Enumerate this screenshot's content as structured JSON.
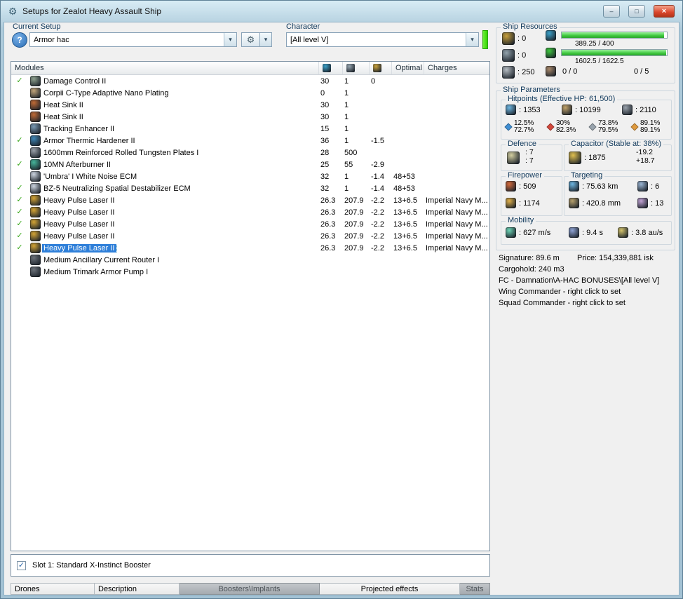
{
  "colors": {
    "selection_blue": "#2e7fd9",
    "check_green": "#33a513",
    "resource_bar_green": "#3ec83e",
    "character_status_green": "#35d400",
    "close_button_red": "#d9452b",
    "resist_em": "#3f8fd4",
    "resist_thermal": "#d4483c",
    "resist_kinetic": "#98a3ad",
    "resist_explosive": "#e09b3f"
  },
  "icons": {
    "window_glyph": "⚙",
    "help_glyph": "?",
    "tools_glyph": "⚙",
    "dropdown_glyph": "▾",
    "check_glyph": "✓",
    "minimize_glyph": "–",
    "maximize_glyph": "□",
    "close_glyph": "×"
  },
  "window": {
    "title": "Setups for Zealot Heavy Assault Ship"
  },
  "setup": {
    "current_setup_label": "Current Setup",
    "current_setup_value": "Armor hac",
    "character_label": "Character",
    "character_value": "[All level V]"
  },
  "modules": {
    "header_label": "Modules",
    "optimal_label": "Optimal",
    "charges_label": "Charges",
    "rows": [
      {
        "active": true,
        "icon": "damage-control",
        "name": "Damage Control II",
        "cpu": "30",
        "pg": "1",
        "cap": "0",
        "optimal": "",
        "charges": "",
        "selected": false
      },
      {
        "active": false,
        "icon": "adaptive-nano-plating",
        "name": "Corpii C-Type Adaptive Nano Plating",
        "cpu": "0",
        "pg": "1",
        "cap": "",
        "optimal": "",
        "charges": "",
        "selected": false
      },
      {
        "active": false,
        "icon": "heat-sink",
        "name": "Heat Sink II",
        "cpu": "30",
        "pg": "1",
        "cap": "",
        "optimal": "",
        "charges": "",
        "selected": false
      },
      {
        "active": false,
        "icon": "heat-sink",
        "name": "Heat Sink II",
        "cpu": "30",
        "pg": "1",
        "cap": "",
        "optimal": "",
        "charges": "",
        "selected": false
      },
      {
        "active": false,
        "icon": "tracking-enhancer",
        "name": "Tracking Enhancer II",
        "cpu": "15",
        "pg": "1",
        "cap": "",
        "optimal": "",
        "charges": "",
        "selected": false
      },
      {
        "active": true,
        "icon": "armor-hardener",
        "name": "Armor Thermic Hardener II",
        "cpu": "36",
        "pg": "1",
        "cap": "-1.5",
        "optimal": "",
        "charges": "",
        "selected": false
      },
      {
        "active": false,
        "icon": "armor-plate",
        "name": "1600mm Reinforced Rolled Tungsten Plates I",
        "cpu": "28",
        "pg": "500",
        "cap": "",
        "optimal": "",
        "charges": "",
        "selected": false
      },
      {
        "active": true,
        "icon": "afterburner",
        "name": "10MN Afterburner II",
        "cpu": "25",
        "pg": "55",
        "cap": "-2.9",
        "optimal": "",
        "charges": "",
        "selected": false
      },
      {
        "active": false,
        "icon": "ecm",
        "name": "'Umbra' I White Noise ECM",
        "cpu": "32",
        "pg": "1",
        "cap": "-1.4",
        "optimal": "48+53",
        "charges": "",
        "selected": false
      },
      {
        "active": true,
        "icon": "ecm",
        "name": "BZ-5 Neutralizing Spatial Destabilizer ECM",
        "cpu": "32",
        "pg": "1",
        "cap": "-1.4",
        "optimal": "48+53",
        "charges": "",
        "selected": false
      },
      {
        "active": true,
        "icon": "pulse-laser",
        "name": "Heavy Pulse Laser II",
        "cpu": "26.3",
        "pg": "207.9",
        "cap": "-2.2",
        "optimal": "13+6.5",
        "charges": "Imperial Navy M...",
        "selected": false
      },
      {
        "active": true,
        "icon": "pulse-laser",
        "name": "Heavy Pulse Laser II",
        "cpu": "26.3",
        "pg": "207.9",
        "cap": "-2.2",
        "optimal": "13+6.5",
        "charges": "Imperial Navy M...",
        "selected": false
      },
      {
        "active": true,
        "icon": "pulse-laser",
        "name": "Heavy Pulse Laser II",
        "cpu": "26.3",
        "pg": "207.9",
        "cap": "-2.2",
        "optimal": "13+6.5",
        "charges": "Imperial Navy M...",
        "selected": false
      },
      {
        "active": true,
        "icon": "pulse-laser",
        "name": "Heavy Pulse Laser II",
        "cpu": "26.3",
        "pg": "207.9",
        "cap": "-2.2",
        "optimal": "13+6.5",
        "charges": "Imperial Navy M...",
        "selected": false
      },
      {
        "active": true,
        "icon": "pulse-laser",
        "name": "Heavy Pulse Laser II",
        "cpu": "26.3",
        "pg": "207.9",
        "cap": "-2.2",
        "optimal": "13+6.5",
        "charges": "Imperial Navy M...",
        "selected": true
      },
      {
        "active": false,
        "icon": "rig",
        "name": "Medium Ancillary Current Router I",
        "cpu": "",
        "pg": "",
        "cap": "",
        "optimal": "",
        "charges": "",
        "selected": false
      },
      {
        "active": false,
        "icon": "rig",
        "name": "Medium Trimark Armor Pump I",
        "cpu": "",
        "pg": "",
        "cap": "",
        "optimal": "",
        "charges": "",
        "selected": false
      }
    ]
  },
  "booster": {
    "label": "Slot 1: Standard X-Instinct Booster",
    "checked": true
  },
  "bottom_tabs": [
    {
      "label": "Drones",
      "pressed": false
    },
    {
      "label": "Description",
      "pressed": false
    },
    {
      "label": "Boosters\\Implants",
      "pressed": true
    },
    {
      "label": "Projected effects",
      "pressed": false
    },
    {
      "label": "Stats",
      "pressed": true
    }
  ],
  "ship_resources": {
    "title": "Ship Resources",
    "turret_hardpoints": "0",
    "launcher_hardpoints": "0",
    "calibration": "250",
    "cpu_text": "389.25 / 400",
    "cpu_pct": 97,
    "powergrid_text": "1602.5 / 1622.5",
    "powergrid_pct": 99,
    "drone_bay": "0 / 0",
    "drone_slots": "0 / 5"
  },
  "ship_parameters": {
    "title": "Ship Parameters",
    "hitpoints": {
      "title": "Hitpoints (Effective HP: 61,500)",
      "shield": "1353",
      "armor": "10199",
      "hull": "2110",
      "resists": [
        {
          "type": "em",
          "shield": "12.5%",
          "armor": "72.7%"
        },
        {
          "type": "thermal",
          "shield": "30%",
          "armor": "82.3%"
        },
        {
          "type": "kinetic",
          "shield": "73.8%",
          "armor": "79.5%"
        },
        {
          "type": "explosive",
          "shield": "89.1%",
          "armor": "89.1%"
        }
      ]
    },
    "defence": {
      "title": "Defence",
      "value1": "7",
      "value2": "7"
    },
    "capacitor": {
      "title": "Capacitor (Stable at: 38%)",
      "capacity": "1875",
      "usage": "-19.2",
      "recharge": "+18.7"
    },
    "firepower": {
      "title": "Firepower",
      "dps": "509",
      "volley": "1174"
    },
    "targeting": {
      "title": "Targeting",
      "range": "75.63 km",
      "max_targets": "6",
      "scan_resolution": "420.8 mm",
      "sensor_strength": "13"
    },
    "mobility": {
      "title": "Mobility",
      "speed": "627 m/s",
      "align_time": "9.4 s",
      "warp_speed": "3.8 au/s"
    }
  },
  "summary": {
    "signature": "Signature: 89.6 m",
    "price": "Price: 154,339,881 isk",
    "cargohold": "Cargohold: 240 m3",
    "fleet_line1": "FC - Damnation\\A-HAC BONUSES\\[All level V]",
    "fleet_line2": "Wing Commander - right click to set",
    "fleet_line3": "Squad Commander - right click to set"
  }
}
